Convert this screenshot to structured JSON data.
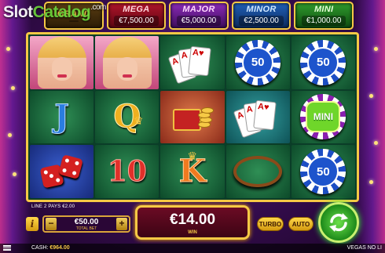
{
  "watermark": {
    "part1": "Slot",
    "part2": "Catalog",
    "domain": ".com"
  },
  "jackpots": [
    {
      "key": "grand",
      "label": "GRAND",
      "value": ""
    },
    {
      "key": "mega",
      "label": "MEGA",
      "value": "€7,500.00"
    },
    {
      "key": "major",
      "label": "MAJOR",
      "value": "€5,000.00"
    },
    {
      "key": "minor",
      "label": "MINOR",
      "value": "€2,500.00"
    },
    {
      "key": "mini",
      "label": "MINI",
      "value": "€1,000.00"
    }
  ],
  "reels": {
    "symbols": [
      [
        "woman",
        "woman",
        "cards",
        "chip-50",
        "chip-50"
      ],
      [
        "J",
        "Q",
        "money-case",
        "cards",
        "chip-mini"
      ],
      [
        "dice",
        "10",
        "K",
        "roulette",
        "chip-50"
      ]
    ],
    "chip_value": "50",
    "mini_label": "MINI",
    "letters": {
      "j": "J",
      "q": "Q",
      "ten": "10",
      "k": "K"
    }
  },
  "bottom": {
    "line_pays": "LINE 2 PAYS €2.00",
    "info_label": "i",
    "bet_amount": "€50.00",
    "bet_label": "TOTAL BET",
    "minus_label": "−",
    "plus_label": "+",
    "win_amount": "€14.00",
    "win_label": "WIN",
    "turbo_label": "TURBO",
    "auto_label": "AUTO"
  },
  "status": {
    "cash_label": "CASH:",
    "cash_value": "€964.00",
    "game_name": "VEGAS NO LI"
  },
  "icons": {
    "spin": "spin-arrows-icon",
    "menu": "hamburger-menu-icon",
    "info": "info-icon"
  },
  "colors": {
    "frame_gold": "#f6c945",
    "spin_green": "#3bb82a",
    "reel_bg": "#0b3d28"
  }
}
